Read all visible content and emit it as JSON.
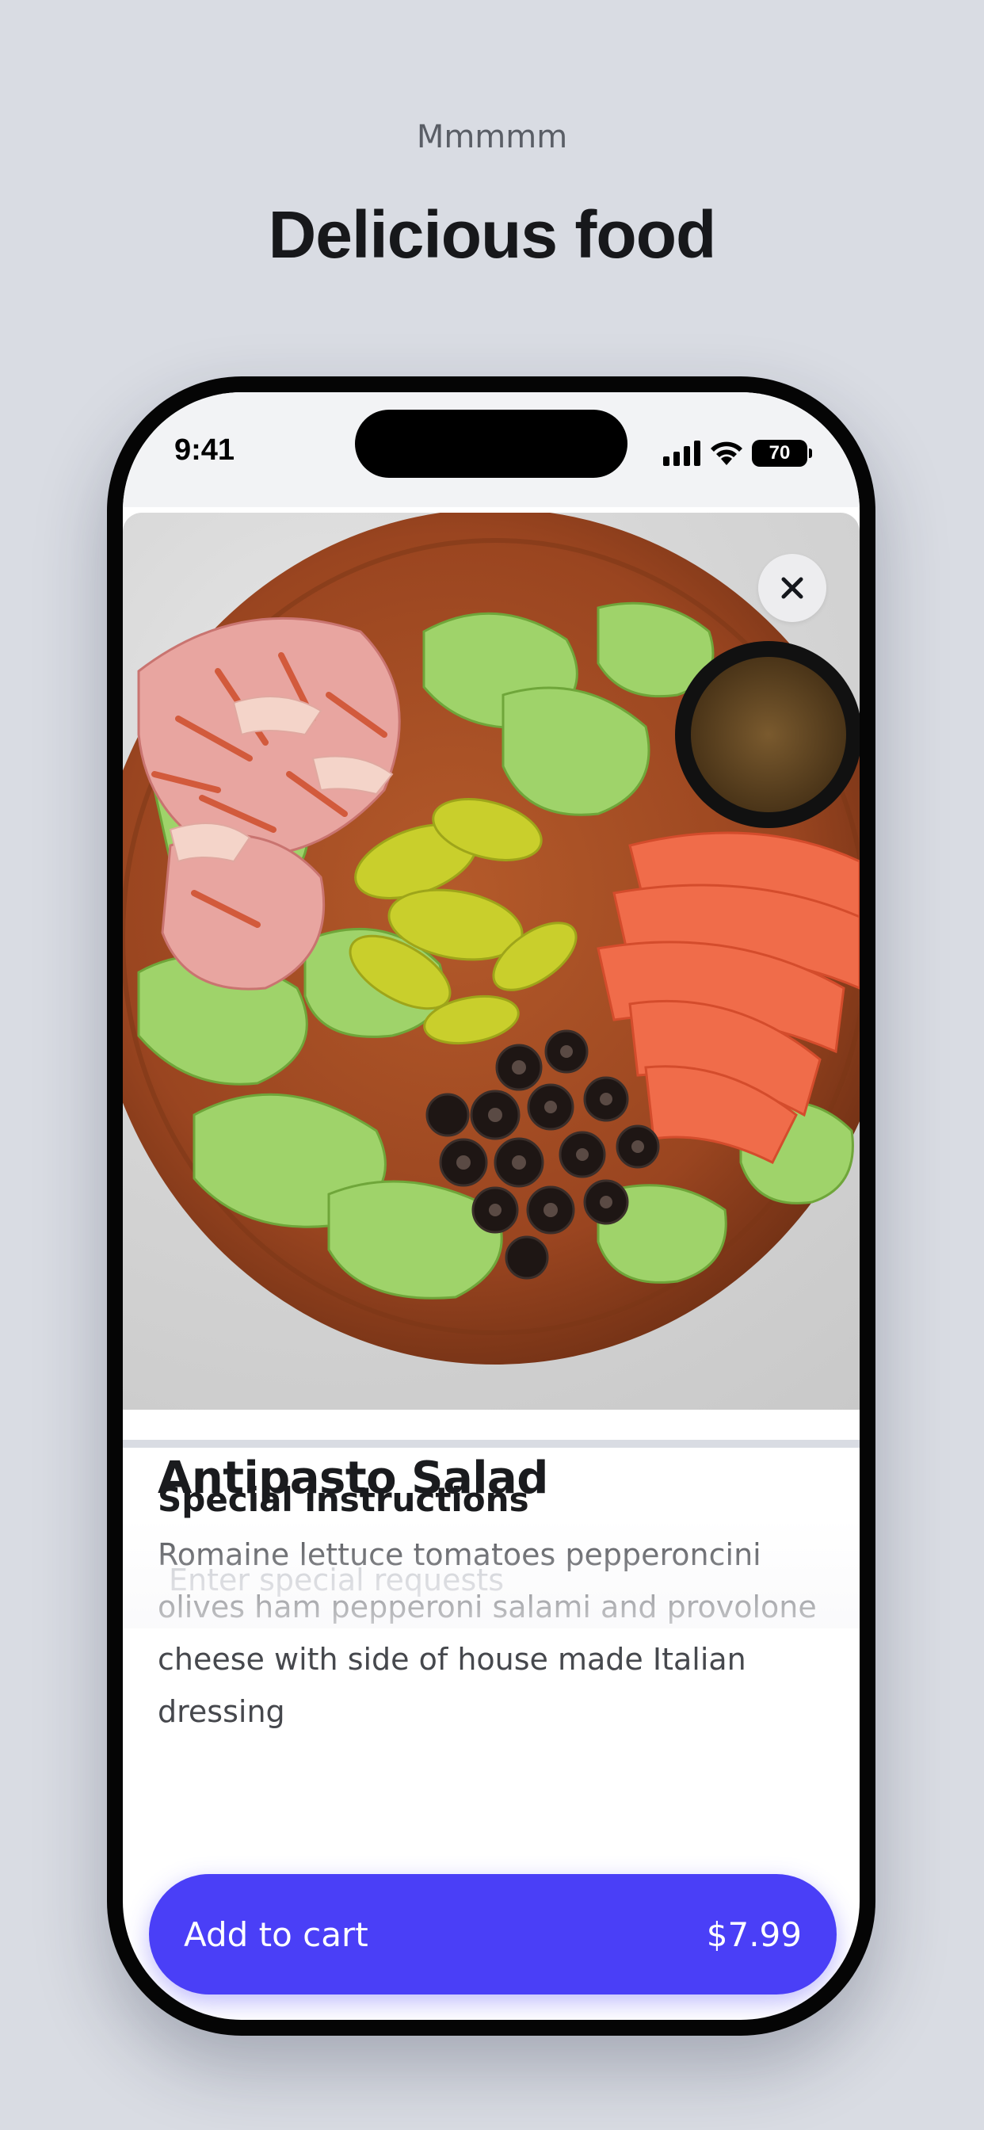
{
  "header": {
    "eyebrow": "Mmmmm",
    "title": "Delicious food"
  },
  "status_bar": {
    "time": "9:41",
    "battery": "70",
    "icons": [
      "signal-icon",
      "wifi-icon",
      "battery-icon"
    ]
  },
  "item": {
    "image_alt": "food-image",
    "name": "Antipasto Salad",
    "description": "Romaine lettuce tomatoes pepperoncini olives ham pepperoni salami and provolone cheese with side of house made Italian dressing"
  },
  "special_instructions": {
    "title": "Special instructions",
    "placeholder": "Enter special requests"
  },
  "cart": {
    "label": "Add to cart",
    "price": "$7.99"
  },
  "colors": {
    "background": "#d9dce3",
    "accent": "#4a3ff7",
    "text": "#1a1b1e"
  }
}
